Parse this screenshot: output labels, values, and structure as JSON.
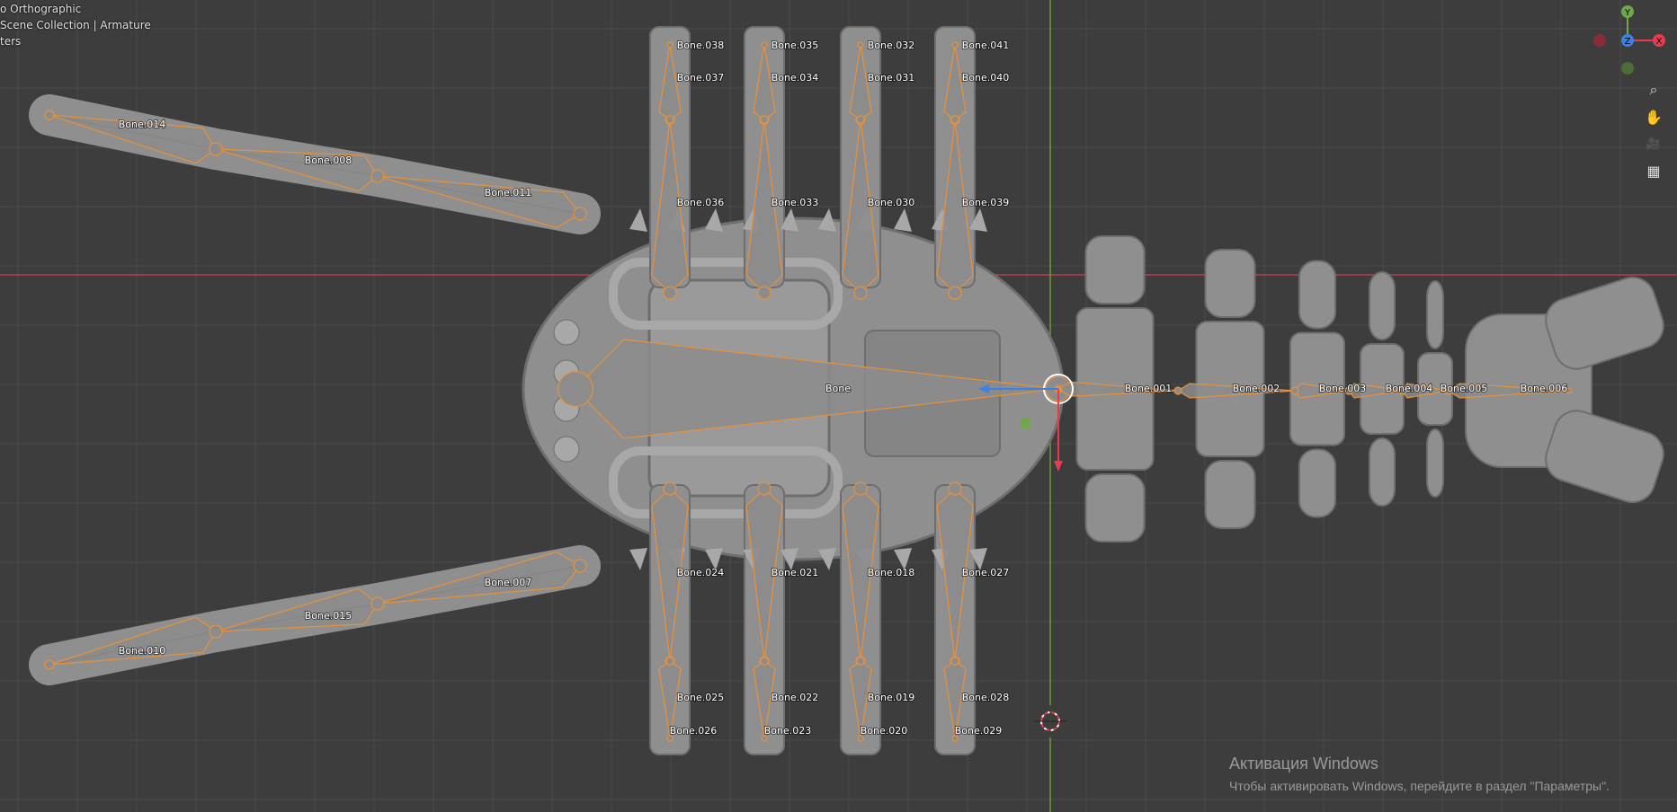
{
  "header": {
    "view_label": "o Orthographic",
    "collection_label": " Scene Collection | Armature",
    "filter_label": "ters"
  },
  "gizmo": {
    "axes": {
      "x": "X",
      "y": "Y",
      "z": "Z"
    },
    "colors": {
      "x": "#e83b4f",
      "y": "#6fa84a",
      "z": "#3b82e8",
      "neg_x": "#8a2c38",
      "neg_y": "#4a6e35"
    }
  },
  "nav_tools": [
    {
      "name": "zoom-icon",
      "glyph": "⌕"
    },
    {
      "name": "pan-hand-icon",
      "glyph": "✋"
    },
    {
      "name": "camera-icon",
      "glyph": "🎥"
    },
    {
      "name": "grid-view-icon",
      "glyph": "▦"
    }
  ],
  "bones": {
    "main": "Bone",
    "tail": [
      "Bone.001",
      "Bone.002",
      "Bone.003",
      "Bone.004",
      "Bone.005",
      "Bone.006"
    ],
    "top_arm": [
      "Bone.011",
      "Bone.008",
      "Bone.014"
    ],
    "bottom_arm": [
      "Bone.007",
      "Bone.015",
      "Bone.010"
    ],
    "top_legs": [
      [
        "Bone.036",
        "Bone.037",
        "Bone.038"
      ],
      [
        "Bone.033",
        "Bone.034",
        "Bone.035"
      ],
      [
        "Bone.030",
        "Bone.031",
        "Bone.032"
      ],
      [
        "Bone.039",
        "Bone.040",
        "Bone.041"
      ]
    ],
    "bottom_legs": [
      [
        "Bone.024",
        "Bone.025",
        "Bone.026"
      ],
      [
        "Bone.021",
        "Bone.022",
        "Bone.023"
      ],
      [
        "Bone.018",
        "Bone.019",
        "Bone.020"
      ],
      [
        "Bone.027",
        "Bone.028",
        "Bone.029"
      ]
    ]
  },
  "colors": {
    "background": "#3d3d3d",
    "grid_line": "#4a4a4a",
    "x_axis_line": "#b5404a",
    "y_axis_line": "#6b9a3a",
    "bone_fill": "#8c8c8c",
    "bone_outline": "#e8913a",
    "mesh": "#8f8f8f"
  },
  "activation": {
    "title": "Активация Windows",
    "message": "Чтобы активировать Windows, перейдите в раздел \"Параметры\"."
  }
}
